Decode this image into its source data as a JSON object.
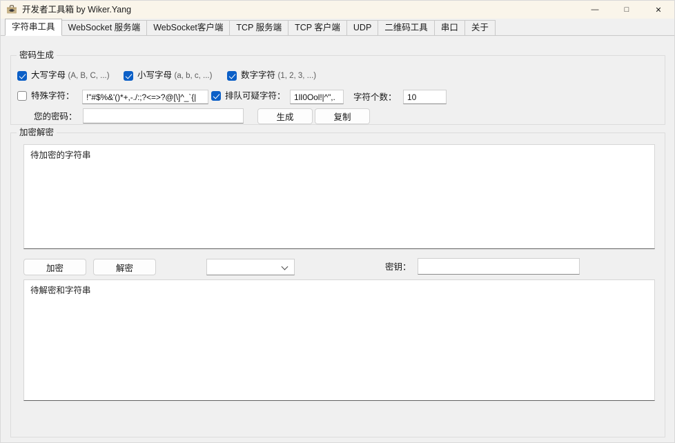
{
  "window": {
    "title": "开发者工具箱 by Wiker.Yang",
    "icon": "toolbox-icon",
    "controls": {
      "minimize": "—",
      "maximize": "□",
      "close": "✕"
    }
  },
  "tabs": [
    {
      "label": "字符串工具",
      "active": true
    },
    {
      "label": "WebSocket 服务端",
      "active": false
    },
    {
      "label": "WebSocket客户端",
      "active": false
    },
    {
      "label": "TCP 服务端",
      "active": false
    },
    {
      "label": "TCP 客户端",
      "active": false
    },
    {
      "label": "UDP",
      "active": false
    },
    {
      "label": "二维码工具",
      "active": false
    },
    {
      "label": "串口",
      "active": false
    },
    {
      "label": "关于",
      "active": false
    }
  ],
  "password_group": {
    "legend": "密码生成",
    "checkboxes": [
      {
        "label": "大写字母",
        "hint": "(A, B, C, ...)",
        "checked": true
      },
      {
        "label": "小写字母",
        "hint": "(a, b, c, ...)",
        "checked": true
      },
      {
        "label": "数字字符",
        "hint": "(1, 2, 3, ...)",
        "checked": true
      }
    ],
    "special_chars": {
      "label": "特殊字符：",
      "checked": false,
      "value": "!\"#$%&'()*+,-./:;?<=>?@[\\]^_`{|"
    },
    "ambiguous_chars": {
      "label": "排队可疑字符：",
      "checked": true,
      "value": "1lI0Ool!|^\",."
    },
    "length": {
      "label": "字符个数：",
      "value": "10"
    },
    "password": {
      "label": "您的密码：",
      "value": "",
      "placeholder": ""
    },
    "generate_button": "生成",
    "copy_button": "复制"
  },
  "crypto_group": {
    "legend": "加密解密",
    "input_area": {
      "placeholder": "待加密的字符串",
      "value": ""
    },
    "encrypt_button": "加密",
    "decrypt_button": "解密",
    "algorithm_select": {
      "value": "",
      "options": []
    },
    "key": {
      "label": "密钥：",
      "value": ""
    },
    "output_area": {
      "placeholder": "待解密和字符串",
      "value": ""
    }
  },
  "colors": {
    "titlebar_bg": "#faf5ea",
    "window_bg": "#f0f0f0",
    "accent_checkbox": "#0b5fc7",
    "field_bg": "#ffffff",
    "border": "#dcdcdc"
  }
}
